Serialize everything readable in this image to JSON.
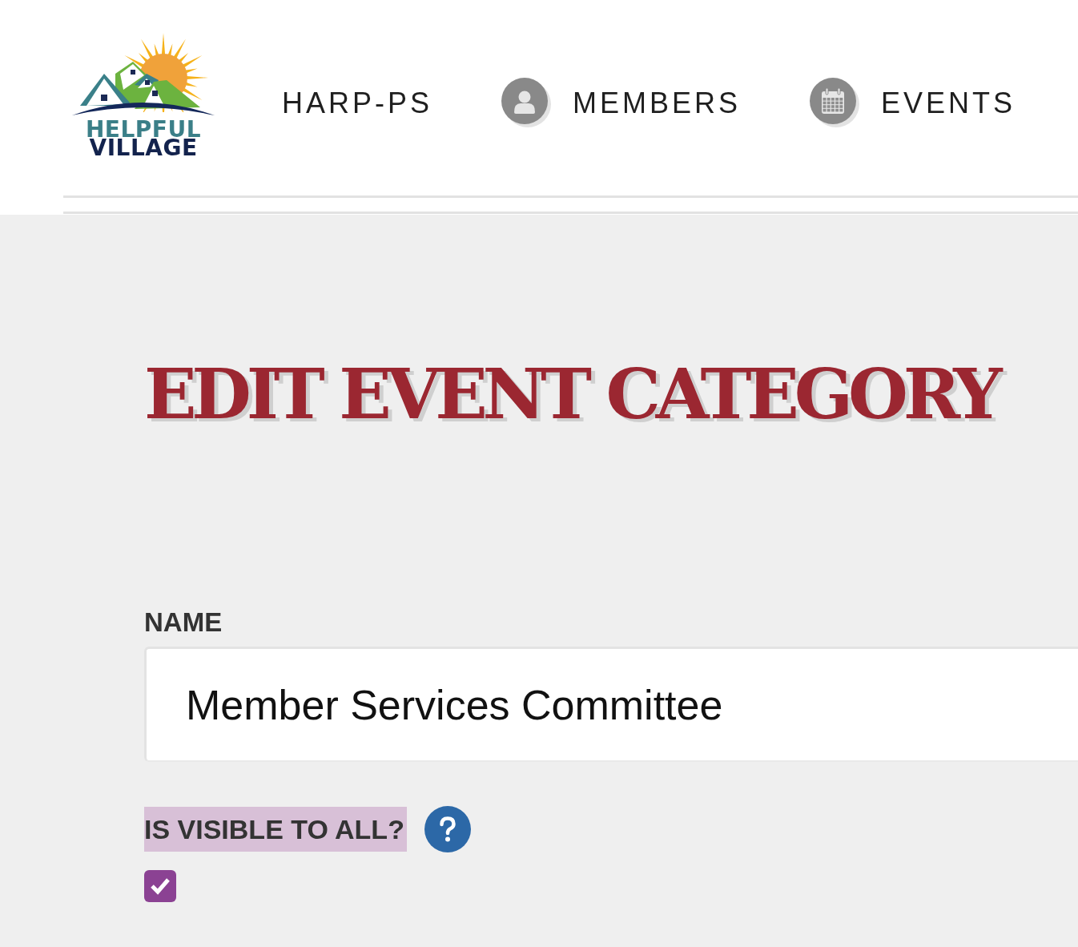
{
  "header": {
    "logo": {
      "line_1": "HELPFUL",
      "line_2": "VILLAGE"
    },
    "nav": [
      {
        "label": "HARP-PS",
        "kind": "plain"
      },
      {
        "label": "MEMBERS",
        "kind": "person"
      },
      {
        "label": "EVENTS",
        "kind": "calendar"
      }
    ]
  },
  "page_title": "EDIT EVENT CATEGORY",
  "form": {
    "name": {
      "label": "NAME",
      "value": "Member Services Committee"
    },
    "visible": {
      "label": "IS VISIBLE TO ALL?",
      "highlighted": true,
      "checked": true
    }
  }
}
